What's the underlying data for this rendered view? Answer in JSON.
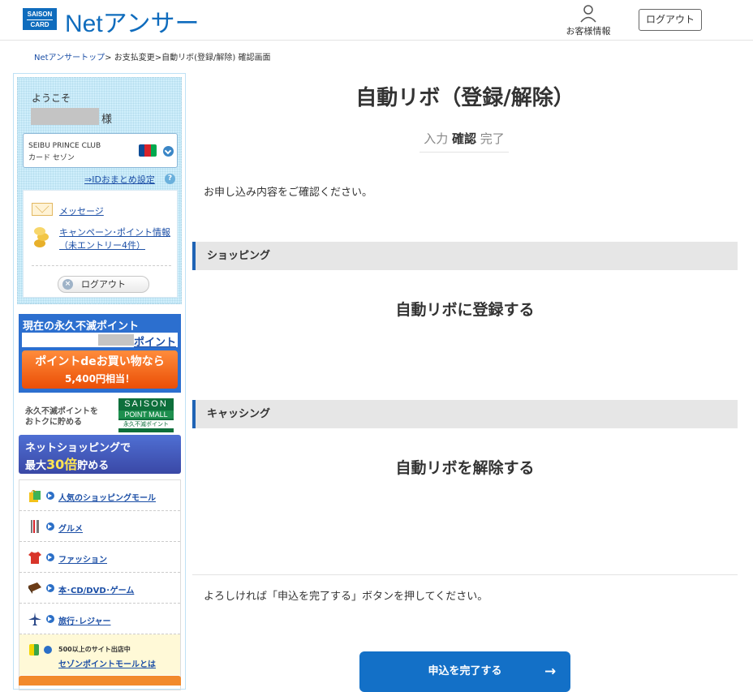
{
  "header": {
    "logo_top": "SAISON",
    "logo_bottom": "CARD",
    "brand": "Netアンサー",
    "account_label": "お客様情報",
    "logout_label": "ログアウト"
  },
  "breadcrumb": {
    "top_link": "Netアンサートップ",
    "rest": "> お支払変更>自動リボ(登録/解除) 確認画面"
  },
  "sidebar": {
    "welcome": "ようこそ",
    "sama": "様",
    "card_name_line1": "SEIBU PRINCE CLUB",
    "card_name_line2": "カード セゾン",
    "card_brand": "JCB",
    "id_link": "⇒IDおまとめ設定",
    "help": "?",
    "message_link": "メッセージ",
    "campaign_link": "キャンペーン･ポイント情報（未エントリー4件）",
    "logout_label": "ログアウト",
    "points_title": "現在の永久不滅ポイント",
    "points_unit": "ポイント",
    "buy_line1": "ポイントdeお買い物なら",
    "buy_line2": "5,400円相当！",
    "mall_text_line1": "永久不滅ポイントを",
    "mall_text_line2": "おトクに貯める",
    "mall_badge_line1": "SAISON",
    "mall_badge_line2": "POINT MALL",
    "mall_badge_line3": "永久不滅ポイント",
    "net_banner_line1": "ネットショッピングで",
    "net_banner_prefix": "最大",
    "net_banner_number": "30倍",
    "net_banner_suffix": "貯める",
    "categories": [
      {
        "label": "人気のショッピングモール",
        "icon": "shopping-bag-icon"
      },
      {
        "label": "グルメ",
        "icon": "cutlery-icon"
      },
      {
        "label": "ファッション",
        "icon": "shirt-icon"
      },
      {
        "label": "本･CD/DVD･ゲーム",
        "icon": "book-icon"
      },
      {
        "label": "旅行･レジャー",
        "icon": "airplane-icon"
      }
    ],
    "note_line1": "500以上のサイト出店中",
    "note_link": "セゾンポイントモールとは"
  },
  "main": {
    "title": "自動リボ（登録/解除）",
    "steps": [
      "入力",
      "確認",
      "完了"
    ],
    "current_step": "確認",
    "intro": "お申し込み内容をご確認ください。",
    "sections": [
      {
        "heading": "ショッピング",
        "value": "自動リボに登録する"
      },
      {
        "heading": "キャッシング",
        "value": "自動リボを解除する"
      }
    ],
    "confirm_note": "よろしければ「申込を完了する」ボタンを押してください。",
    "submit_label": "申込を完了する"
  },
  "colors": {
    "brand_blue": "#0f6cbd",
    "section_accent": "#1f63b5",
    "submit_bg": "#1370c7",
    "points_orange": "#ea4e06"
  }
}
